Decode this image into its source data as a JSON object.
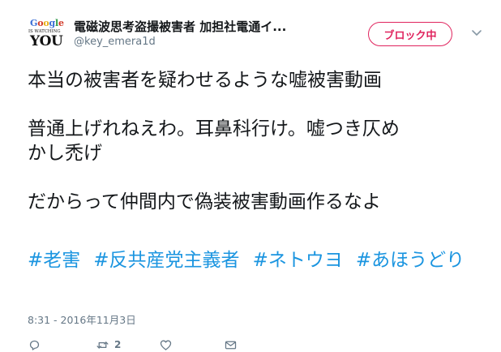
{
  "user": {
    "display_name": "電磁波思考盗撮被害者 加担社電通イ...",
    "handle": "@key_emera1d",
    "avatar": {
      "line1": "Google",
      "line2": "IS WATCHING",
      "line3": "YOU"
    }
  },
  "header": {
    "block_button_label": "ブロック中",
    "menu_icon": "chevron-down-icon"
  },
  "tweet": {
    "lines": [
      "本当の被害者を疑わせるような嘘被害動画",
      "",
      "普通上げれねえわ。耳鼻科行け。嘘つき仄め",
      "かし禿げ",
      "",
      "だからって仲間内で偽装被害動画作るなよ"
    ],
    "hashtags": [
      "#老害",
      "#反共産党主義者",
      "#ネトウヨ",
      "#あほうどり"
    ],
    "timestamp": "8:31 - 2016年11月3日"
  },
  "actions": {
    "reply_icon": "reply-icon",
    "retweet_icon": "retweet-icon",
    "retweet_count": "2",
    "like_icon": "heart-icon",
    "message_icon": "envelope-icon"
  },
  "colors": {
    "block_red": "#e0245e",
    "hashtag_blue": "#1b95e0",
    "muted_gray": "#657786"
  }
}
